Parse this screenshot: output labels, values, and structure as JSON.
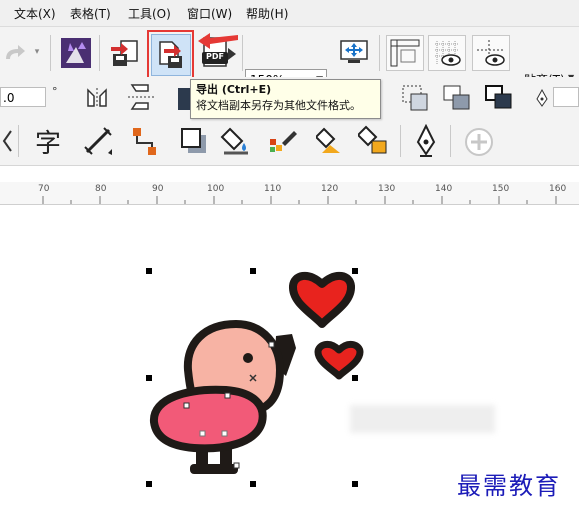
{
  "menubar": {
    "items": [
      "文本(X)",
      "表格(T)",
      "工具(O)",
      "窗口(W)",
      "帮助(H)"
    ]
  },
  "toolbar": {
    "zoom_value": "150%",
    "snap_label": "贴齐(T)",
    "number_field_value": ".0",
    "degree_symbol": "°",
    "pdf_label": "PDF",
    "text_tool_glyph": "字"
  },
  "tooltip": {
    "title": "导出 (Ctrl+E)",
    "description": "将文档副本另存为其他文件格式。"
  },
  "ruler": {
    "ticks": [
      "70",
      "80",
      "90",
      "100",
      "110",
      "120",
      "130",
      "140",
      "150",
      "160"
    ]
  },
  "watermark": {
    "text": "最需教育"
  },
  "colors": {
    "highlight_red": "#e53935",
    "heart_red": "#e8231e",
    "bird_body": "#f7b3a4",
    "bird_wing": "#f25a78",
    "outline": "#1f1a17"
  },
  "icons": {
    "back_arrow": "redo-arrow-icon",
    "import": "import-icon",
    "export": "export-icon",
    "export_pdf": "export-pdf-icon",
    "fit": "zoom-fit-icon",
    "text_tool": "text-tool-icon"
  }
}
